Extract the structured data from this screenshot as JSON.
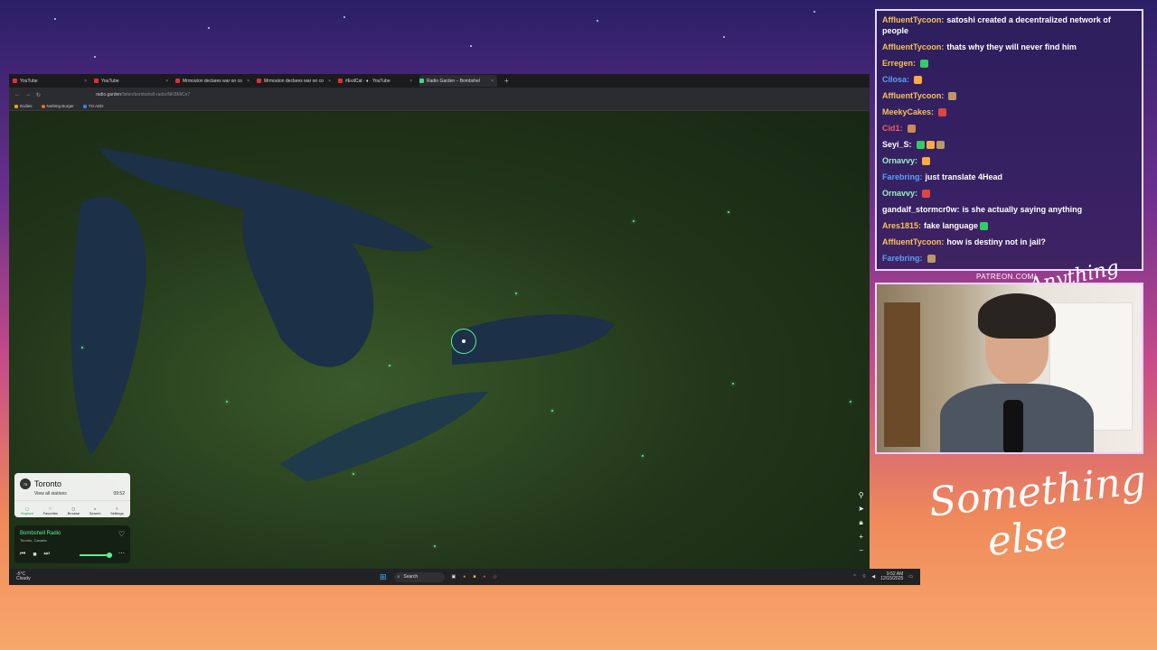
{
  "browser": {
    "tabs": [
      {
        "label": "YouTube"
      },
      {
        "label": "YouTube"
      },
      {
        "label": "Mrmouton declares war on co"
      },
      {
        "label": "Mrmouton declares war on co"
      },
      {
        "label": "#EvilCat · ♦ · YouTube"
      },
      {
        "label": "Radio Garden – Bombshel"
      }
    ],
    "url_host": "radio.garden",
    "url_path": "/listen/bombshell-radio/NKBMiCe7",
    "bookmarks": [
      "Dailies",
      "Nothing Burger",
      "TO ADD"
    ]
  },
  "radio": {
    "city": "Toronto",
    "city_badge": "75",
    "view_all": "View all stations",
    "time": "09:52",
    "nav": [
      "Explore",
      "Favorites",
      "Browse",
      "Search",
      "Settings"
    ],
    "station": "Bombshell Radio",
    "station_location": "Toronto, Canada"
  },
  "taskbar": {
    "temp": "-5°C",
    "weather": "Cloudy",
    "search": "Search",
    "time": "9:52 AM",
    "date": "12/15/2025"
  },
  "chat": [
    {
      "user": "AffluentTycoon:",
      "text": "satoshi created a decentralized network of people",
      "color": "#f7c25a",
      "emotes": 0
    },
    {
      "user": "AffluentTycoon:",
      "text": "thats why they will never find him",
      "color": "#f7c25a",
      "emotes": 0
    },
    {
      "user": "Erregen:",
      "text": "",
      "color": "#f7c25a",
      "emotes": 1
    },
    {
      "user": "Cilosa:",
      "text": "",
      "color": "#5aa0f7",
      "emotes": 1
    },
    {
      "user": "AffluentTycoon:",
      "text": "",
      "color": "#f7c25a",
      "emotes": 1
    },
    {
      "user": "MeekyCakes:",
      "text": "",
      "color": "#f7c25a",
      "emotes": 1
    },
    {
      "user": "Cid1:",
      "text": "",
      "color": "#f75a5a",
      "emotes": 1
    },
    {
      "user": "Seyi_S:",
      "text": "",
      "color": "#ffffff",
      "emotes": 3
    },
    {
      "user": "Ornavvy:",
      "text": "",
      "color": "#a0f0c0",
      "emotes": 1
    },
    {
      "user": "Farebring:",
      "text": "just translate 4Head",
      "color": "#5aa0f7",
      "emotes": 0
    },
    {
      "user": "Ornavvy:",
      "text": "",
      "color": "#a0f0c0",
      "emotes": 1
    },
    {
      "user": "gandalf_stormcr0w:",
      "text": "is she actually saying anything",
      "color": "#ffffff",
      "emotes": 0
    },
    {
      "user": "Ares1815:",
      "text": "fake language",
      "color": "#f7c25a",
      "emotes": 1
    },
    {
      "user": "AffluentTycoon:",
      "text": "how is destiny not in jail?",
      "color": "#f7c25a",
      "emotes": 0
    },
    {
      "user": "Farebring:",
      "text": "",
      "color": "#5aa0f7",
      "emotes": 1
    }
  ],
  "overlay": {
    "patreon": "PATREON.COM/",
    "script_small": "Anything else?",
    "script_large_1": "Something",
    "script_large_2": "else"
  },
  "colors": {
    "accent": "#5cf096",
    "chat_border": "#e8d8ff"
  }
}
